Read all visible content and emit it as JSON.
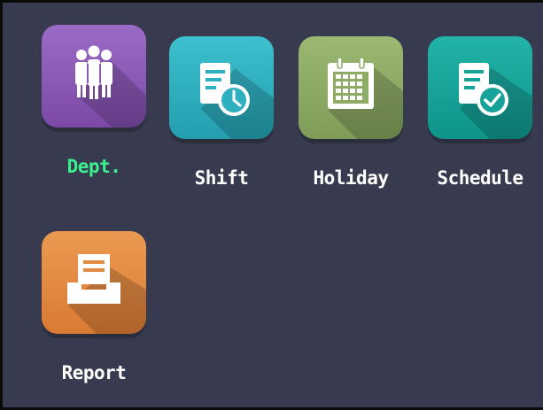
{
  "menu": {
    "items": [
      {
        "key": "dept",
        "label": "Dept.",
        "icon": "department-people-icon",
        "color": "#8d5cb8",
        "selected": true
      },
      {
        "key": "shift",
        "label": "Shift",
        "icon": "shift-schedule-clock-icon",
        "color": "#2fb0c0",
        "selected": false
      },
      {
        "key": "holiday",
        "label": "Holiday",
        "icon": "holiday-calendar-icon",
        "color": "#8fac66",
        "selected": false
      },
      {
        "key": "schedule",
        "label": "Schedule",
        "icon": "schedule-document-check-icon",
        "color": "#16a49a",
        "selected": false
      },
      {
        "key": "report",
        "label": "Report",
        "icon": "report-tray-icon",
        "color": "#e38a42",
        "selected": false
      }
    ]
  },
  "colors": {
    "background": "#383b4f",
    "selected_label": "#3bf08f",
    "label": "#ffffff"
  }
}
